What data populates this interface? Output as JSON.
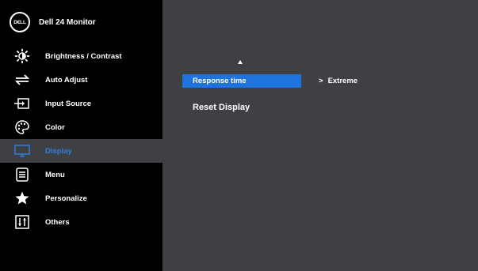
{
  "header": {
    "logo_text": "D€LL",
    "model": "Dell 24 Monitor"
  },
  "menu": [
    {
      "label": "Brightness / Contrast",
      "icon": "brightness-icon"
    },
    {
      "label": "Auto Adjust",
      "icon": "auto-adjust-icon"
    },
    {
      "label": "Input Source",
      "icon": "input-source-icon"
    },
    {
      "label": "Color",
      "icon": "color-palette-icon"
    },
    {
      "label": "Display",
      "icon": "display-icon",
      "active": true
    },
    {
      "label": "Menu",
      "icon": "menu-icon"
    },
    {
      "label": "Personalize",
      "icon": "star-icon"
    },
    {
      "label": "Others",
      "icon": "others-icon"
    }
  ],
  "display_panel": {
    "scroll_up": "▲",
    "options": [
      {
        "label": "Response time",
        "selected": true,
        "value_prefix": ">",
        "value": "Extreme"
      },
      {
        "label": "Reset Display",
        "selected": false
      }
    ]
  },
  "colors": {
    "accent": "#1f73de",
    "active_text": "#2f7fe0",
    "panel_bg": "#3f4043",
    "sidebar_bg": "#000000"
  }
}
